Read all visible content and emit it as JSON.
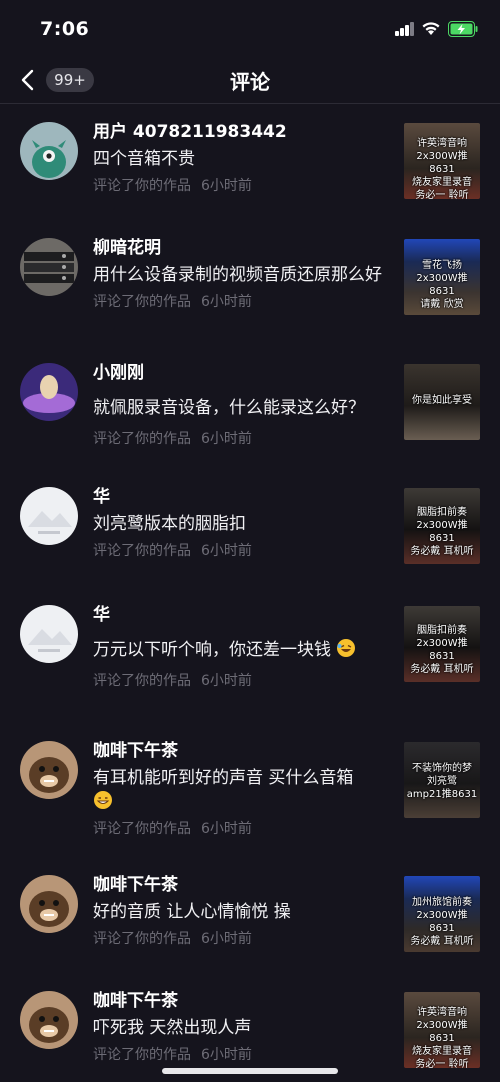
{
  "status": {
    "time": "7:06"
  },
  "nav": {
    "badge": "99+",
    "title": "评论"
  },
  "comments": [
    {
      "user": "用户 4078211983442",
      "text": "四个音箱不贵",
      "action": "评论了你的作品",
      "time": "6小时前",
      "avatar": "green-monster-avatar",
      "thumb_lines": [
        "许英湾音响",
        "2x300W推8631",
        "烧友家里录音",
        "务必一 聆听"
      ]
    },
    {
      "user": "柳暗花明",
      "text": "用什么设备录制的视频音质还原那么好",
      "action": "评论了你的作品",
      "time": "6小时前",
      "avatar": "equipment-avatar",
      "thumb_lines": [
        "雪花飞扬",
        "2x300W推8631",
        "请戴 欣赏"
      ]
    },
    {
      "user": "小刚刚",
      "text": "就佩服录音设备，什么能录这么好？",
      "action": "评论了你的作品",
      "time": "6小时前",
      "avatar": "egg-avatar",
      "thumb_lines": [
        "你是如此享受"
      ]
    },
    {
      "user": "华",
      "text": "刘亮鹭版本的胭脂扣",
      "action": "评论了你的作品",
      "time": "6小时前",
      "avatar": "placeholder-avatar",
      "thumb_lines": [
        "胭脂扣前奏",
        "2x300W推8631",
        "务必戴 耳机听"
      ]
    },
    {
      "user": "华",
      "text": "万元以下听个响，你还差一块钱",
      "action": "评论了你的作品",
      "time": "6小时前",
      "avatar": "placeholder-avatar",
      "emoji": "laughing-emoji",
      "thumb_lines": [
        "胭脂扣前奏",
        "2x300W推8631",
        "务必戴 耳机听"
      ]
    },
    {
      "user": "咖啡下午茶",
      "text": "有耳机能听到好的声音 买什么音箱",
      "action": "评论了你的作品",
      "time": "6小时前",
      "avatar": "dog-avatar",
      "emoji": "grin-emoji",
      "thumb_lines": [
        "不装饰你的梦",
        "刘亮鹭",
        "amp21推8631"
      ]
    },
    {
      "user": "咖啡下午茶",
      "text": "好的音质 让人心情愉悦 操",
      "action": "评论了你的作品",
      "time": "6小时前",
      "avatar": "dog-avatar",
      "thumb_lines": [
        "加州旅馆前奏",
        "2x300W推8631",
        "务必戴 耳机听"
      ]
    },
    {
      "user": "咖啡下午茶",
      "text": "吓死我 天然出现人声",
      "action": "评论了你的作品",
      "time": "6小时前",
      "avatar": "dog-avatar",
      "thumb_lines": [
        "许英湾音响",
        "2x300W推8631",
        "烧友家里录音",
        "务必一 聆听"
      ]
    }
  ],
  "colors": {
    "background": "#15141d",
    "meta": "#6d6c76",
    "badge_bg": "#3a3943",
    "battery": "#4cd964"
  }
}
